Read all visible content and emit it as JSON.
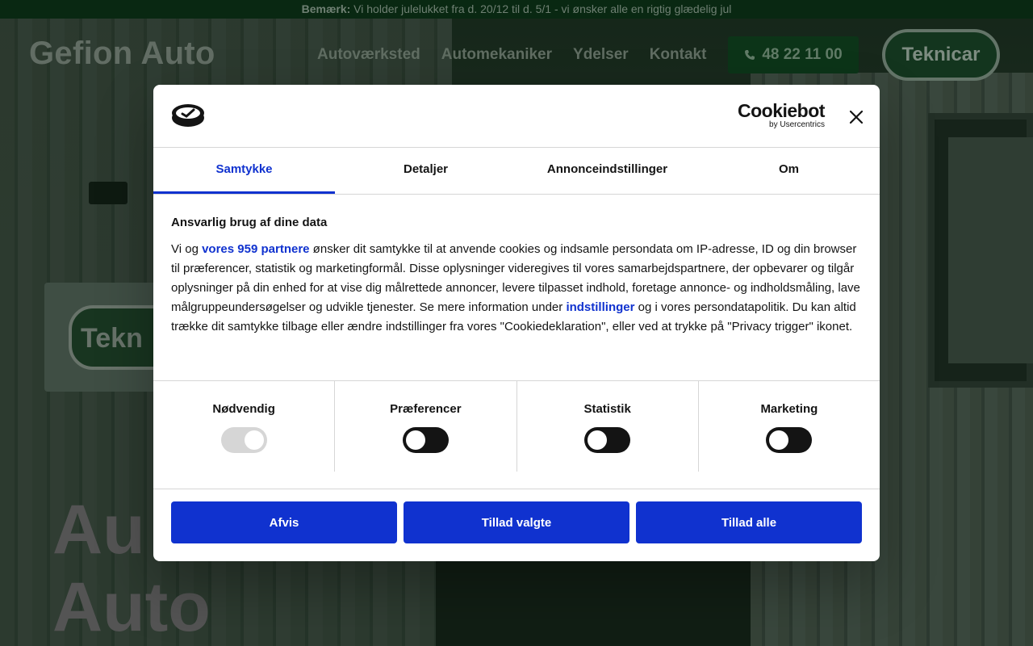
{
  "site": {
    "notice_label": "Bemærk:",
    "notice_text": " Vi holder julelukket fra d. 20/12 til d. 5/1 - vi ønsker alle en rigtig glædelig jul",
    "logo": "Gefion Auto",
    "nav": [
      "Autoværksted",
      "Automekaniker",
      "Ydelser",
      "Kontakt"
    ],
    "phone": "48 22 11 00",
    "partner_logo": "Teknicar",
    "hero_line1": "Au",
    "hero_line2": "Auto"
  },
  "dialog": {
    "cookiebot_main": "Cookiebot",
    "cookiebot_sub": "by Usercentrics",
    "tabs": [
      "Samtykke",
      "Detaljer",
      "Annonceindstillinger",
      "Om"
    ],
    "active_tab": "Samtykke",
    "heading": "Ansvarlig brug af dine data",
    "body_pre": "Vi og ",
    "body_link1": "vores 959 partnere",
    "body_mid": " ønsker dit samtykke til at anvende cookies og indsamle persondata om IP-adresse, ID og din browser til præferencer, statistik og marketingformål. Disse oplysninger videregives til vores samarbejdspartnere, der opbevarer og tilgår oplysninger på din enhed for at vise dig målrettede annoncer, levere tilpasset indhold, foretage annonce- og indholdsmåling, lave målgruppeundersøgelser og udvikle tjenester. Se mere information under ",
    "body_link2": "indstillinger",
    "body_post": " og i vores persondatapolitik. Du kan altid trække dit samtykke tilbage eller ændre indstillinger fra vores \"Cookiedeklaration\", eller ved at trykke på \"Privacy trigger\" ikonet.",
    "toggles": [
      {
        "label": "Nødvendig",
        "state": "on",
        "disabled": true
      },
      {
        "label": "Præferencer",
        "state": "off",
        "disabled": false
      },
      {
        "label": "Statistik",
        "state": "off",
        "disabled": false
      },
      {
        "label": "Marketing",
        "state": "off",
        "disabled": false
      }
    ],
    "buttons": {
      "deny": "Afvis",
      "allow_selected": "Tillad valgte",
      "allow_all": "Tillad alle"
    }
  },
  "colors": {
    "accent": "#1032cf",
    "notice_bg": "#0b2d15"
  }
}
